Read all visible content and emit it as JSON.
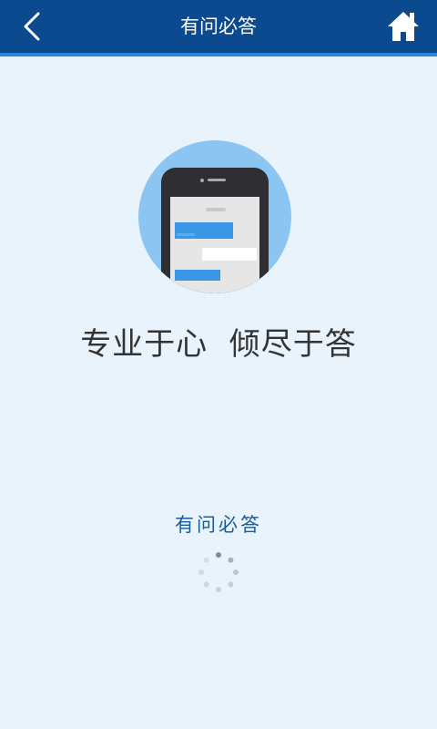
{
  "header": {
    "title": "有问必答",
    "back_icon": "chevron-left-icon",
    "home_icon": "home-icon",
    "background_color": "#0b4a8f",
    "accent_color": "#2a86d8"
  },
  "main": {
    "slogan": "专业于心  倾尽于答",
    "brand_name": "有问必答",
    "illustration_icon": "phone-chat-icon",
    "loading_icon": "loading-spinner-icon"
  },
  "colors": {
    "page_background": "#e8f3fc",
    "brand_text": "#1a5c9a",
    "illustration_circle": "#8cc4f2",
    "message_bubble": "#3a97e8"
  }
}
